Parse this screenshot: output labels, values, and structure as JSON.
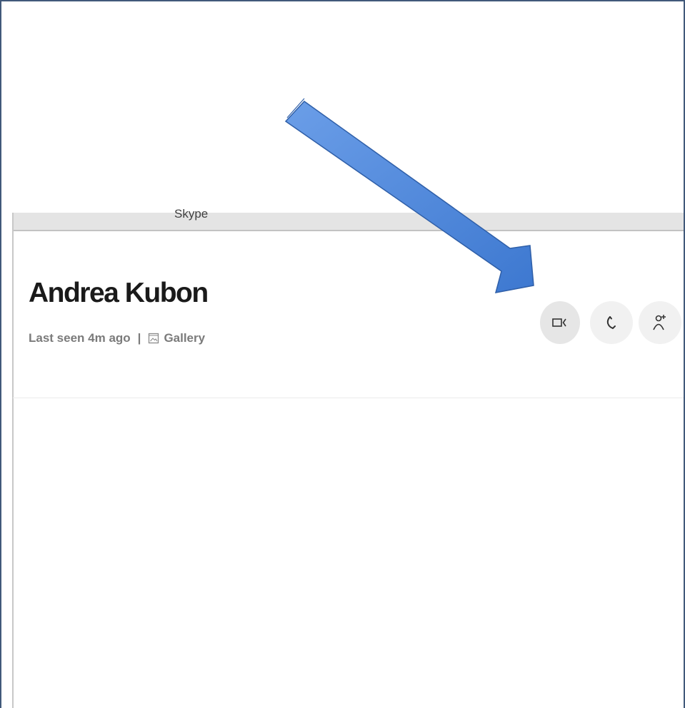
{
  "window": {
    "title": "Skype"
  },
  "contact": {
    "name": "Andrea Kubon",
    "last_seen": "Last seen 4m ago",
    "separator": "|",
    "gallery_label": "Gallery"
  },
  "actions": {
    "video_call_icon": "video-camera-icon",
    "audio_call_icon": "phone-icon",
    "add_person_icon": "add-person-icon"
  },
  "annotation": {
    "arrow_color": "#4a86dc"
  },
  "colors": {
    "frame_border": "#41597a",
    "button_bg": "#f1f1f1"
  }
}
